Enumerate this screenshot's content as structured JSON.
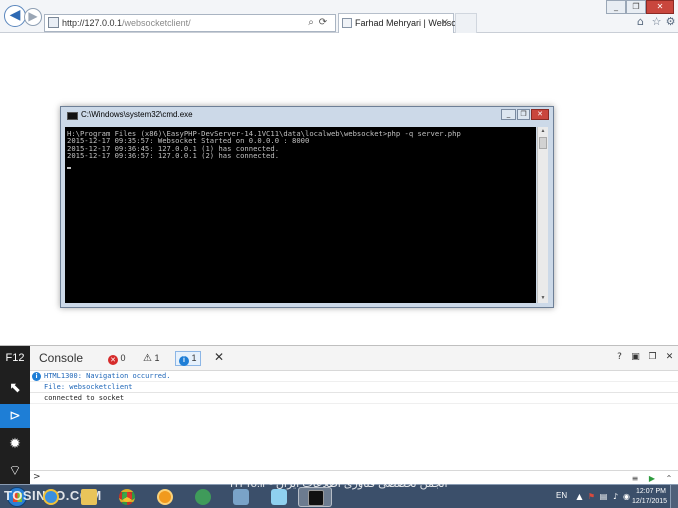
{
  "browser": {
    "url_host": "http://127.0.0.1",
    "url_path": "/websocketclient/",
    "tab_title": "Farhad Mehryari | Websock...",
    "tab_close": "×"
  },
  "cmd": {
    "title": "C:\\Windows\\system32\\cmd.exe",
    "lines": [
      "H:\\Program Files (x86)\\EasyPHP-DevServer-14.1VC11\\data\\localweb\\websocket>php -q server.php",
      "2015-12-17 09:35:57: Websocket Started on 0.0.0.0 : 8000",
      "2015-12-17 09:36:45: 127.0.0.1 (1) has connected.",
      "2015-12-17 09:36:57: 127.0.0.1 (2) has connected."
    ]
  },
  "devtools": {
    "f12_label": "F12",
    "console_title": "Console",
    "errors_count": "0",
    "warnings_count": "1",
    "info_count": "1",
    "messages": [
      {
        "text": "HTML1300: Navigation occurred.",
        "color": "#1e66b8"
      },
      {
        "text": "File: websocketclient",
        "color": "#1e66b8"
      },
      {
        "text": "connected to socket",
        "color": "#222222"
      }
    ],
    "prompt": ">"
  },
  "taskbar": {
    "watermark_left": "TOSINSO.COM",
    "watermark_mid": "ITPro.ir - انجمن تخصصی فناوری اطلاعات ایران",
    "lang": "EN",
    "time": "12:07 PM",
    "date": "12/17/2015"
  },
  "colors": {
    "f12_accent": "#1e7ed6",
    "cmd_background": "#000000",
    "taskbar": "#3b4f6a"
  }
}
